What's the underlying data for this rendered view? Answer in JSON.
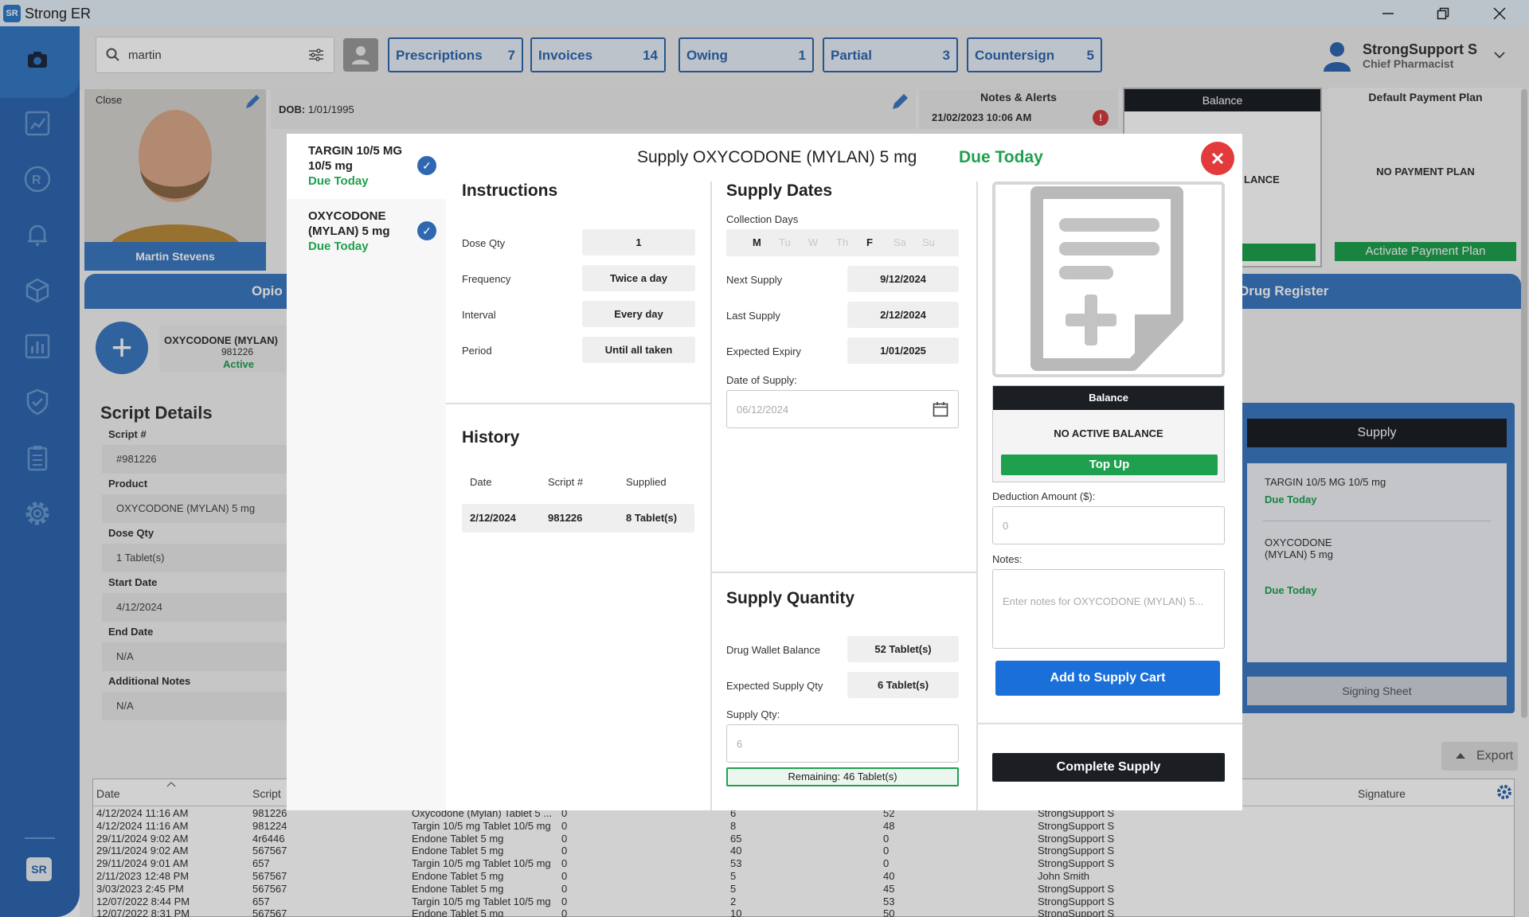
{
  "window": {
    "title": "Strong ER",
    "logo_text": "SR"
  },
  "search": {
    "value": "martin"
  },
  "tabs": [
    {
      "label": "Prescriptions",
      "count": "7"
    },
    {
      "label": "Invoices",
      "count": "14"
    },
    {
      "label": "Owing",
      "count": "1"
    },
    {
      "label": "Partial",
      "count": "3"
    },
    {
      "label": "Countersign",
      "count": "5"
    }
  ],
  "user": {
    "name": "StrongSupport S",
    "role": "Chief Pharmacist"
  },
  "patient": {
    "close_label": "Close",
    "name": "Martin Stevens",
    "dob_label": "DOB:",
    "dob": "1/01/1995"
  },
  "notes": {
    "title": "Notes & Alerts",
    "datetime": "21/02/2023 10:06 AM",
    "alert": "!"
  },
  "balance_panel": {
    "title": "Balance",
    "text": "LANCE"
  },
  "payment_plan": {
    "title": "Default Payment Plan",
    "text": "NO PAYMENT PLAN",
    "button": "Activate Payment Plan"
  },
  "section_tabs": {
    "left": "Opio",
    "right": "Drug Register"
  },
  "rx_card": {
    "name": "OXYCODONE (MYLAN)",
    "script": "981226",
    "status": "Active"
  },
  "script_details": {
    "title": "Script Details",
    "fields": [
      {
        "label": "Script #",
        "value": "#981226"
      },
      {
        "label": "Product",
        "value": "OXYCODONE (MYLAN) 5 mg"
      },
      {
        "label": "Dose Qty",
        "value": "1 Tablet(s)"
      },
      {
        "label": "Start Date",
        "value": "4/12/2024"
      },
      {
        "label": "End Date",
        "value": "N/A"
      },
      {
        "label": "Additional Notes",
        "value": "N/A"
      }
    ]
  },
  "supply_panel": {
    "title": "Supply",
    "items": [
      {
        "name": "TARGIN 10/5 MG 10/5 mg",
        "due": "Due Today"
      },
      {
        "name": "OXYCODONE (MYLAN) 5 mg",
        "due": "Due Today"
      }
    ],
    "signing": "Signing Sheet"
  },
  "export_label": "Export",
  "history_table": {
    "headers": [
      "Date",
      "Script",
      "Signature"
    ],
    "rows": [
      [
        "4/12/2024 11:16 AM",
        "981226",
        "Oxycodone (Mylan) Tablet 5 ...",
        "0",
        "6",
        "52",
        "StrongSupport S"
      ],
      [
        "4/12/2024 11:16 AM",
        "981224",
        "Targin 10/5 mg Tablet 10/5 mg",
        "0",
        "8",
        "48",
        "StrongSupport S"
      ],
      [
        "29/11/2024 9:02 AM",
        "4r6446",
        "Endone Tablet 5 mg",
        "0",
        "65",
        "0",
        "StrongSupport S"
      ],
      [
        "29/11/2024 9:02 AM",
        "567567",
        "Endone Tablet 5 mg",
        "0",
        "40",
        "0",
        "StrongSupport S"
      ],
      [
        "29/11/2024 9:01 AM",
        "657",
        "Targin 10/5 mg Tablet 10/5 mg",
        "0",
        "53",
        "0",
        "StrongSupport S"
      ],
      [
        "2/11/2023 12:48 PM",
        "567567",
        "Endone Tablet 5 mg",
        "0",
        "5",
        "40",
        "John Smith"
      ],
      [
        "3/03/2023 2:45 PM",
        "567567",
        "Endone Tablet 5 mg",
        "0",
        "5",
        "45",
        "StrongSupport S"
      ],
      [
        "12/07/2022 8:44 PM",
        "657",
        "Targin 10/5 mg Tablet 10/5 mg",
        "0",
        "2",
        "53",
        "StrongSupport S"
      ],
      [
        "12/07/2022 8:31 PM",
        "567567",
        "Endone Tablet 5 mg",
        "0",
        "10",
        "50",
        "StrongSupport S"
      ]
    ]
  },
  "modal": {
    "title": "Supply OXYCODONE (MYLAN) 5 mg",
    "due": "Due Today",
    "drugs": [
      {
        "name": "TARGIN 10/5 MG 10/5 mg",
        "due": "Due Today"
      },
      {
        "name": "OXYCODONE (MYLAN) 5 mg",
        "due": "Due Today"
      }
    ],
    "instructions": {
      "title": "Instructions",
      "fields": [
        {
          "label": "Dose Qty",
          "value": "1"
        },
        {
          "label": "Frequency",
          "value": "Twice a day"
        },
        {
          "label": "Interval",
          "value": "Every day"
        },
        {
          "label": "Period",
          "value": "Until all taken"
        }
      ]
    },
    "history": {
      "title": "History",
      "headers": [
        "Date",
        "Script #",
        "Supplied"
      ],
      "row": [
        "2/12/2024",
        "981226",
        "8 Tablet(s)"
      ]
    },
    "supply_dates": {
      "title": "Supply Dates",
      "collection_label": "Collection Days",
      "days": [
        {
          "d": "M",
          "on": true
        },
        {
          "d": "Tu",
          "on": false
        },
        {
          "d": "W",
          "on": false
        },
        {
          "d": "Th",
          "on": false
        },
        {
          "d": "F",
          "on": true
        },
        {
          "d": "Sa",
          "on": false
        },
        {
          "d": "Su",
          "on": false
        }
      ],
      "fields": [
        {
          "label": "Next Supply",
          "value": "9/12/2024"
        },
        {
          "label": "Last Supply",
          "value": "2/12/2024"
        },
        {
          "label": "Expected Expiry",
          "value": "1/01/2025"
        }
      ],
      "date_label": "Date of Supply:",
      "date_placeholder": "06/12/2024"
    },
    "supply_quantity": {
      "title": "Supply Quantity",
      "fields": [
        {
          "label": "Drug Wallet Balance",
          "value": "52 Tablet(s)"
        },
        {
          "label": "Expected Supply Qty",
          "value": "6 Tablet(s)"
        }
      ],
      "qty_label": "Supply Qty:",
      "qty_placeholder": "6",
      "remaining": "Remaining: 46 Tablet(s)"
    },
    "balance": {
      "title": "Balance",
      "text": "NO ACTIVE BALANCE",
      "topup": "Top Up"
    },
    "deduction": {
      "label": "Deduction Amount ($):",
      "placeholder": "0"
    },
    "notes": {
      "label": "Notes:",
      "placeholder": "Enter notes for OXYCODONE (MYLAN) 5..."
    },
    "add_cart": "Add to Supply Cart",
    "complete": "Complete Supply"
  },
  "colors": {
    "primary": "#2f67b0",
    "green": "#1fa04f",
    "red": "#e33b3b",
    "dark": "#1b1f24"
  }
}
